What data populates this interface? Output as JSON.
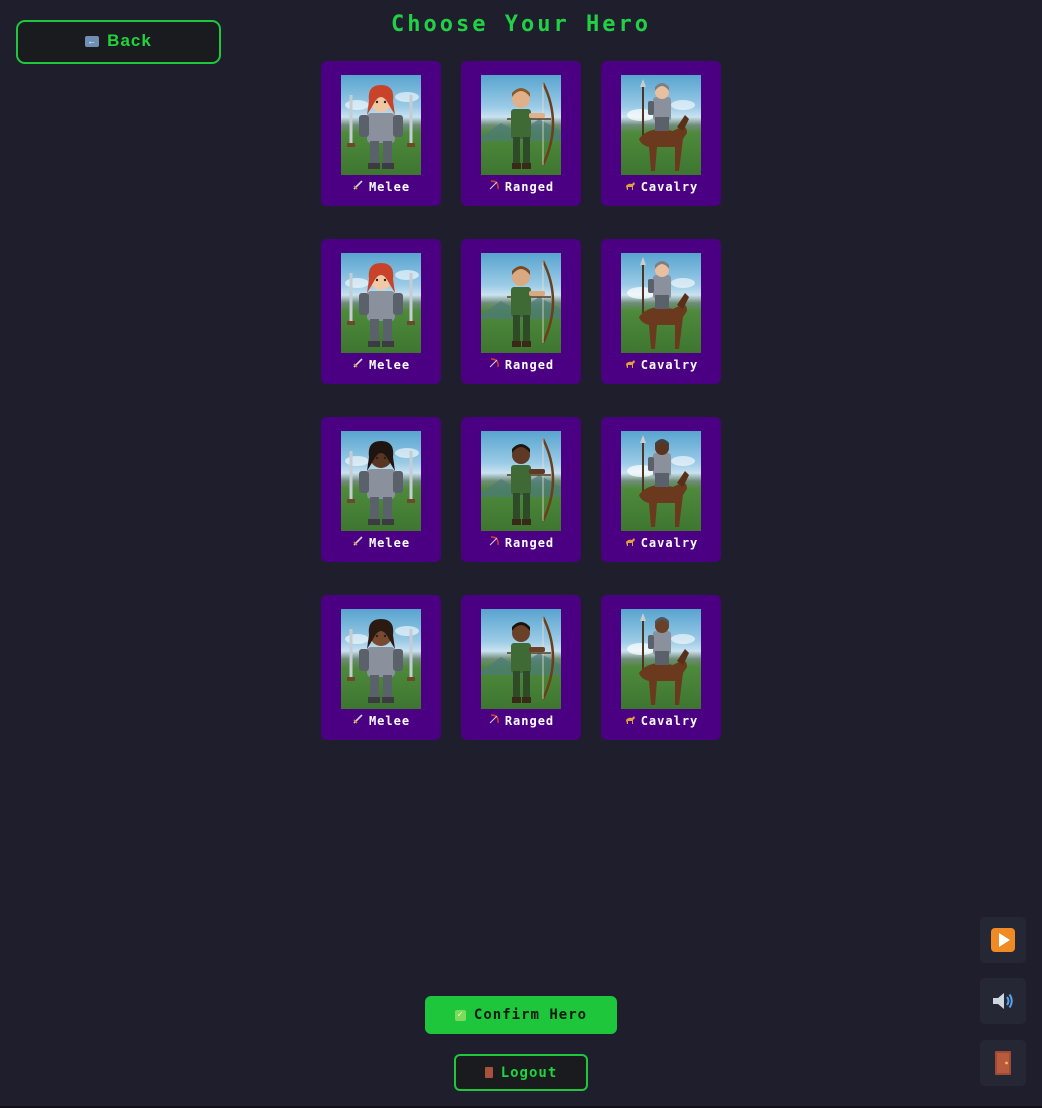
{
  "header": {
    "back_label": "Back",
    "title": "Choose Your Hero"
  },
  "heroes": [
    {
      "label": "Melee",
      "class_icon": "sword-icon",
      "hair": "#c8432a",
      "skin": "#f0c7a3",
      "kind": "melee"
    },
    {
      "label": "Ranged",
      "class_icon": "bow-icon",
      "hair": "#8a5a2c",
      "skin": "#e0b08a",
      "kind": "ranged"
    },
    {
      "label": "Cavalry",
      "class_icon": "horse-icon",
      "hair": "#7a7f86",
      "skin": "#e8c0a0",
      "kind": "cavalry"
    },
    {
      "label": "Melee",
      "class_icon": "sword-icon",
      "hair": "#c8432a",
      "skin": "#f2c9a6",
      "kind": "melee"
    },
    {
      "label": "Ranged",
      "class_icon": "bow-icon",
      "hair": "#7a4a24",
      "skin": "#d9a982",
      "kind": "ranged"
    },
    {
      "label": "Cavalry",
      "class_icon": "horse-icon",
      "hair": "#7a7f86",
      "skin": "#e8c0a0",
      "kind": "cavalry"
    },
    {
      "label": "Melee",
      "class_icon": "sword-icon",
      "hair": "#1e1410",
      "skin": "#5a3622",
      "kind": "melee"
    },
    {
      "label": "Ranged",
      "class_icon": "bow-icon",
      "hair": "#1e1410",
      "skin": "#5e3a24",
      "kind": "ranged"
    },
    {
      "label": "Cavalry",
      "class_icon": "horse-icon",
      "hair": "#3e4248",
      "skin": "#5a3622",
      "kind": "cavalry"
    },
    {
      "label": "Melee",
      "class_icon": "sword-icon",
      "hair": "#2a1a12",
      "skin": "#7a4a2e",
      "kind": "melee"
    },
    {
      "label": "Ranged",
      "class_icon": "bow-icon",
      "hair": "#1a120e",
      "skin": "#6a4028",
      "kind": "ranged"
    },
    {
      "label": "Cavalry",
      "class_icon": "horse-icon",
      "hair": "#50545a",
      "skin": "#6a4028",
      "kind": "cavalry"
    }
  ],
  "footer": {
    "confirm_label": "Confirm Hero",
    "logout_label": "Logout"
  },
  "side_controls": [
    {
      "name": "play-icon"
    },
    {
      "name": "speaker-icon"
    },
    {
      "name": "door-exit-icon"
    }
  ],
  "colors": {
    "background": "#1f1e2d",
    "accent_green": "#1fd43c",
    "card_purple": "#4b0083"
  }
}
